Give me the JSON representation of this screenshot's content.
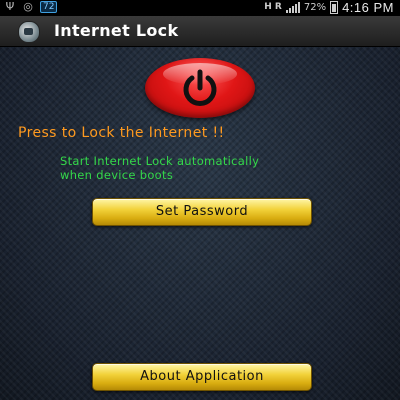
{
  "statusbar": {
    "battery_badge": "72",
    "hr_label": "H R",
    "battery_percent": "72%",
    "time": "4:16 PM"
  },
  "app": {
    "title": "Internet Lock"
  },
  "main": {
    "lock_prompt": "Press to Lock the Internet !!",
    "auto_start_line1": "Start Internet Lock automatically",
    "auto_start_line2": "when device boots",
    "set_password_label": "Set Password",
    "about_label": "About Application"
  },
  "colors": {
    "power_button": "#e01616",
    "lock_prompt": "#ff9a1f",
    "auto_start_text": "#34d84a",
    "button_gold": "#f2d23a"
  },
  "icons": {
    "usb": "usb-icon",
    "app_notification": "app-notification-icon",
    "signal": "signal-icon",
    "battery": "battery-icon",
    "power": "power-icon"
  }
}
